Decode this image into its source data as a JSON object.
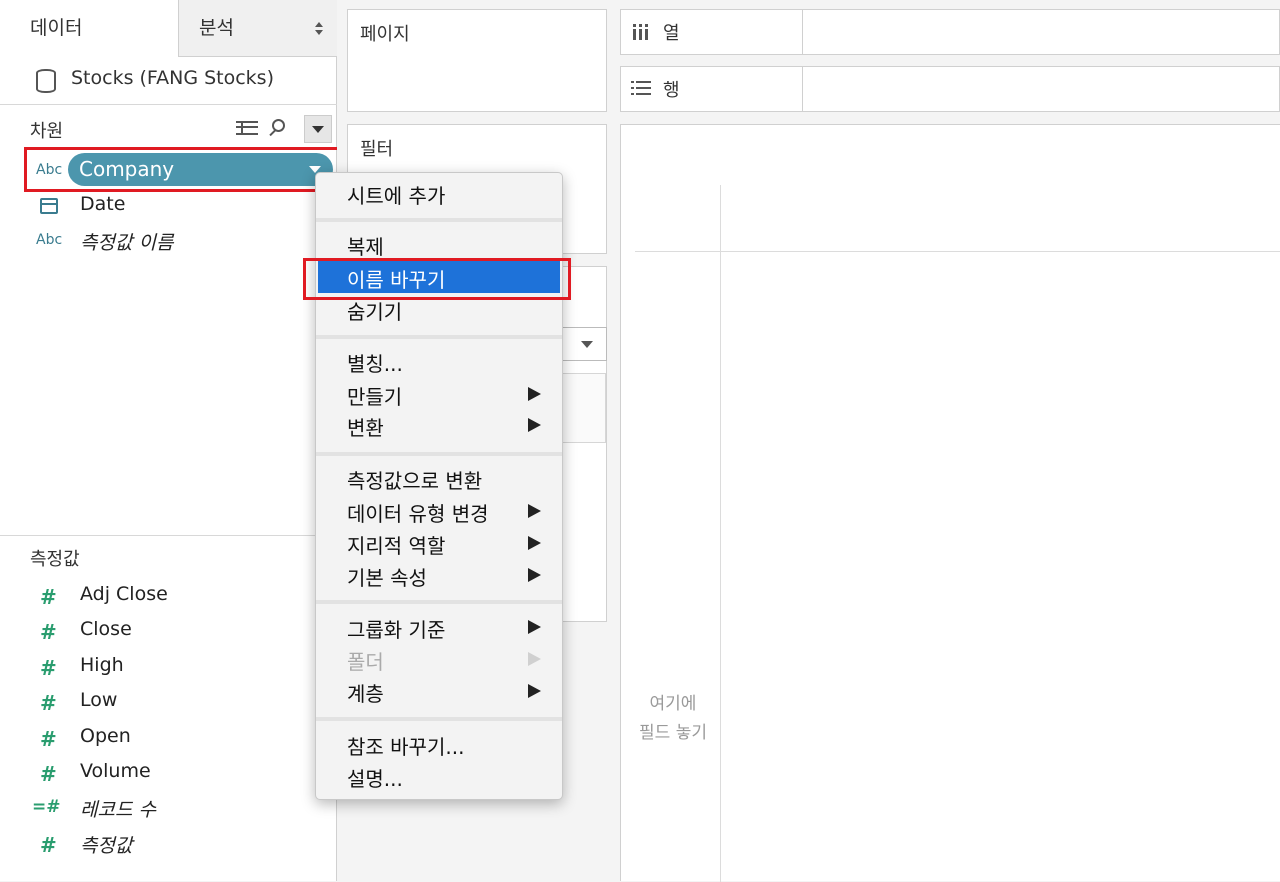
{
  "left_pane": {
    "tabs": {
      "data": "데이터",
      "analysis": "분석"
    },
    "datasource": "Stocks (FANG Stocks)",
    "dimensions": {
      "title": "차원",
      "fields": [
        {
          "type": "Abc",
          "name": "Company"
        },
        {
          "type": "",
          "name": "Date"
        },
        {
          "type": "Abc",
          "name": "측정값 이름"
        }
      ]
    },
    "measures": {
      "title": "측정값",
      "fields": [
        {
          "type": "#",
          "name": "Adj Close"
        },
        {
          "type": "#",
          "name": "Close"
        },
        {
          "type": "#",
          "name": "High"
        },
        {
          "type": "#",
          "name": "Low"
        },
        {
          "type": "#",
          "name": "Open"
        },
        {
          "type": "#",
          "name": "Volume"
        },
        {
          "type": "=#",
          "name": "레코드 수"
        },
        {
          "type": "#",
          "name": "측정값"
        }
      ]
    }
  },
  "cards": {
    "pages": "페이지",
    "filters": "필터"
  },
  "shelves": {
    "columns": "열",
    "rows": "행"
  },
  "canvas": {
    "drop_hint_line1": "여기에",
    "drop_hint_line2": "필드 놓기"
  },
  "context_menu": {
    "items": [
      {
        "label": "시트에 추가"
      },
      {
        "label": "복제"
      },
      {
        "label": "이름 바꾸기",
        "state": "highlighted"
      },
      {
        "label": "숨기기"
      },
      {
        "label": "별칭..."
      },
      {
        "label": "만들기",
        "submenu": true
      },
      {
        "label": "변환",
        "submenu": true
      },
      {
        "label": "측정값으로 변환"
      },
      {
        "label": "데이터 유형 변경",
        "submenu": true
      },
      {
        "label": "지리적 역할",
        "submenu": true
      },
      {
        "label": "기본 속성",
        "submenu": true
      },
      {
        "label": "그룹화 기준",
        "submenu": true
      },
      {
        "label": "폴더",
        "submenu": true,
        "state": "disabled"
      },
      {
        "label": "계층",
        "submenu": true
      },
      {
        "label": "참조 바꾸기..."
      },
      {
        "label": "설명..."
      }
    ]
  },
  "colors": {
    "pill": "#4c96ad",
    "menu_selection": "#1e72d9",
    "annotation_box": "#e01a22",
    "measure_icon": "#2a9d6f",
    "dimension_icon": "#3a7c8f"
  }
}
